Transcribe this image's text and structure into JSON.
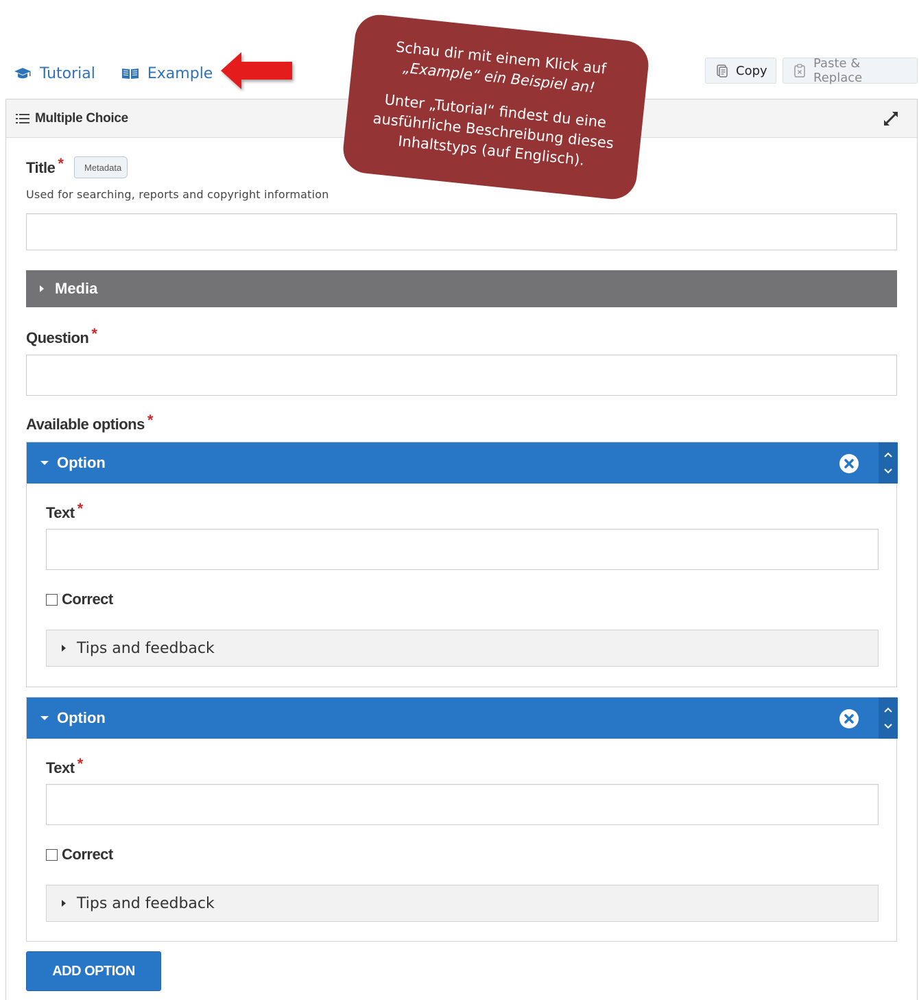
{
  "toplinks": {
    "tutorial": "Tutorial",
    "example": "Example"
  },
  "toolbar": {
    "copy": "Copy",
    "paste_replace": "Paste & Replace"
  },
  "editor": {
    "title": "Multiple Choice",
    "title_field": {
      "label": "Title",
      "required_mark": "*",
      "tag": "Metadata",
      "description": "Used for searching, reports and copyright information",
      "value": ""
    },
    "media": {
      "label": "Media"
    },
    "question": {
      "label": "Question",
      "required_mark": "*",
      "value": ""
    },
    "available_options": {
      "label": "Available options",
      "required_mark": "*",
      "items": [
        {
          "header": "Option",
          "text_label": "Text",
          "required_mark": "*",
          "text_value": "",
          "correct_label": "Correct",
          "correct": false,
          "tips": "Tips and feedback"
        },
        {
          "header": "Option",
          "text_label": "Text",
          "required_mark": "*",
          "text_value": "",
          "correct_label": "Correct",
          "correct": false,
          "tips": "Tips and feedback"
        }
      ]
    },
    "add_option": "ADD OPTION"
  },
  "callout": {
    "line1": "Schau dir mit einem Klick auf",
    "line2": "„Example“ ein Beispiel an!",
    "line3": "Unter „Tutorial“ findest du eine",
    "line4": "ausführliche Beschreibung dieses",
    "line5": "Inhaltstyps (auf Englisch)."
  },
  "colors": {
    "accent": "#2877c6",
    "media_bar": "#737275",
    "callout": "#943434",
    "link": "#2f73b8",
    "required": "#cc2a2a"
  },
  "icons": {
    "tutorial": "graduation-cap-icon",
    "example": "book-open-icon",
    "copy": "copy-icon",
    "paste": "paste-icon",
    "list": "list-icon",
    "expand": "expand-icon",
    "remove": "close-circle-icon",
    "move": "chevron-up-down-icon"
  }
}
